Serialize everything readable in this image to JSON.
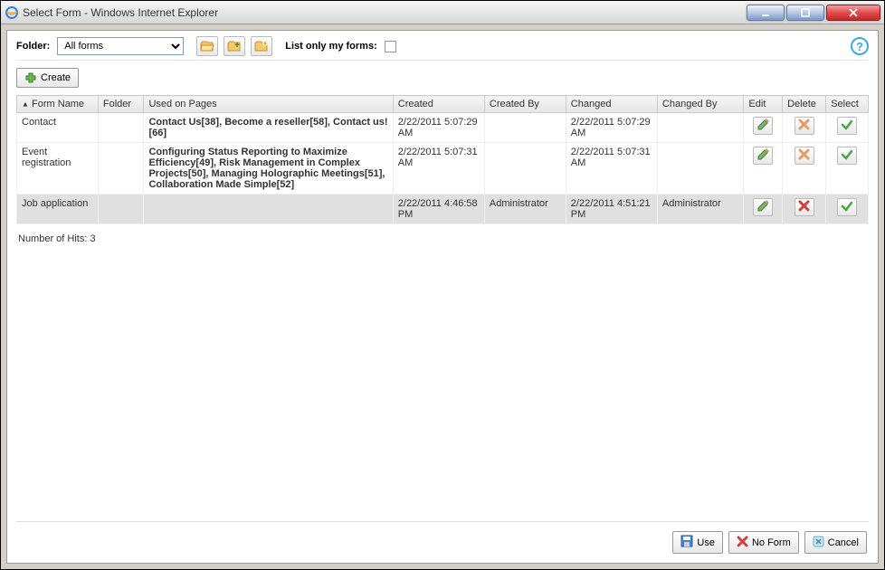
{
  "title": "Select Form - Windows Internet Explorer",
  "toolbar": {
    "folder_label": "Folder:",
    "folder_value": "All forms",
    "list_only_label": "List only my forms:",
    "help_symbol": "?"
  },
  "create": {
    "label": "Create"
  },
  "columns": {
    "form_name": "Form Name",
    "folder": "Folder",
    "usage": "Used on Pages",
    "created": "Created",
    "created_by": "Created By",
    "changed": "Changed",
    "changed_by": "Changed By",
    "edit": "Edit",
    "delete": "Delete",
    "select": "Select",
    "sort_glyph": "▲"
  },
  "rows": [
    {
      "name": "Contact",
      "folder": "",
      "usage": "Contact Us[38], Become a reseller[58], Contact us![66]",
      "created": "2/22/2011 5:07:29 AM",
      "created_by": "",
      "changed": "2/22/2011 5:07:29 AM",
      "changed_by": "",
      "selected": false
    },
    {
      "name": "Event registration",
      "folder": "",
      "usage": "Configuring Status Reporting to Maximize Efficiency[49], Risk Management in Complex Projects[50], Managing Holographic Meetings[51], Collaboration Made Simple[52]",
      "created": "2/22/2011 5:07:31 AM",
      "created_by": "",
      "changed": "2/22/2011 5:07:31 AM",
      "changed_by": "",
      "selected": false
    },
    {
      "name": "Job application",
      "folder": "",
      "usage": "",
      "created": "2/22/2011 4:46:58 PM",
      "created_by": "Administrator",
      "changed": "2/22/2011 4:51:21 PM",
      "changed_by": "Administrator",
      "selected": true
    }
  ],
  "hits": {
    "label": "Number of Hits: ",
    "value": "3"
  },
  "buttons": {
    "use": "Use",
    "no_form": "No Form",
    "cancel": "Cancel"
  }
}
